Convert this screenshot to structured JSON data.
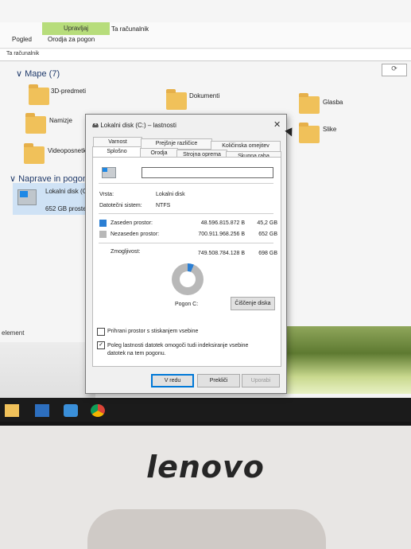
{
  "explorer": {
    "ribbon": {
      "context_tab_top": "Upravljaj",
      "app_title": "Ta računalnik",
      "tab_view": "Pogled",
      "tab_drive_tools": "Orodja za pogon"
    },
    "address": "Ta računalnik",
    "groups": {
      "folders_header": "Mape (7)",
      "devices_header": "Naprave in pogoni"
    },
    "folders": [
      "3D-predmeti",
      "Dokumenti",
      "Glasba",
      "Namizje",
      "Slike",
      "Videoposnetk"
    ],
    "drive": {
      "name": "Lokalni disk (C",
      "free": "652 GB proste"
    },
    "status": "element"
  },
  "dialog": {
    "title": "Lokalni disk (C:) – lastnosti",
    "tabs_row1": [
      "Varnost",
      "Prejšnje različice",
      "Količinska omejitev"
    ],
    "tabs_row2": [
      "Splošno",
      "Orodja",
      "Strojna oprema",
      "Skupna raba"
    ],
    "name_value": "",
    "type_label": "Vrsta:",
    "type_value": "Lokalni disk",
    "fs_label": "Datotečni sistem:",
    "fs_value": "NTFS",
    "used_label": "Zaseden prostor:",
    "used_bytes": "48.596.815.872 B",
    "used_gb": "45,2 GB",
    "free_label": "Nezaseden prostor:",
    "free_bytes": "700.911.968.256 B",
    "free_gb": "652 GB",
    "capacity_label": "Zmogljivost:",
    "capacity_bytes": "749.508.784.128 B",
    "capacity_gb": "698 GB",
    "drive_label": "Pogon C:",
    "cleanup_button": "Čiščenje diska",
    "compress_label": "Prihrani prostor s stiskanjem vsebine",
    "index_label": "Poleg lastnosti datotek omogoči tudi indeksiranje vsebine datotek na tem pogonu.",
    "ok_button": "V redu",
    "cancel_button": "Prekliči",
    "apply_button": "Uporabi",
    "used_fraction": 0.0648,
    "used_color": "#2b7fd4",
    "free_color": "#b8b8b8"
  },
  "brand": "lenovo"
}
